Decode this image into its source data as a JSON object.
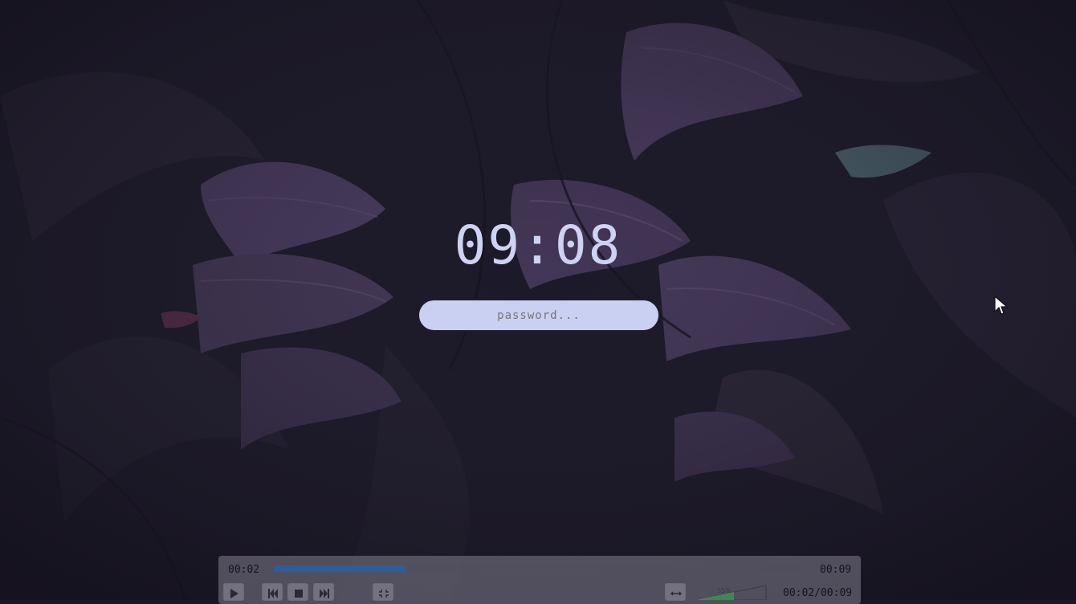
{
  "lockscreen": {
    "time": "09:08",
    "password_placeholder": "password..."
  },
  "player": {
    "elapsed": "00:02",
    "duration": "00:09",
    "progress_fraction": 0.25,
    "volume_label": "55%",
    "time_readout": "00:02/00:09",
    "controls": [
      "play-icon",
      "previous-icon",
      "stop-icon",
      "next-icon",
      "fullscreen-icon",
      "loop-icon"
    ]
  },
  "colors": {
    "clock": "#cfd3f3",
    "input_bg": "#cad0f2",
    "progress_fill": "#2f5d9a"
  }
}
